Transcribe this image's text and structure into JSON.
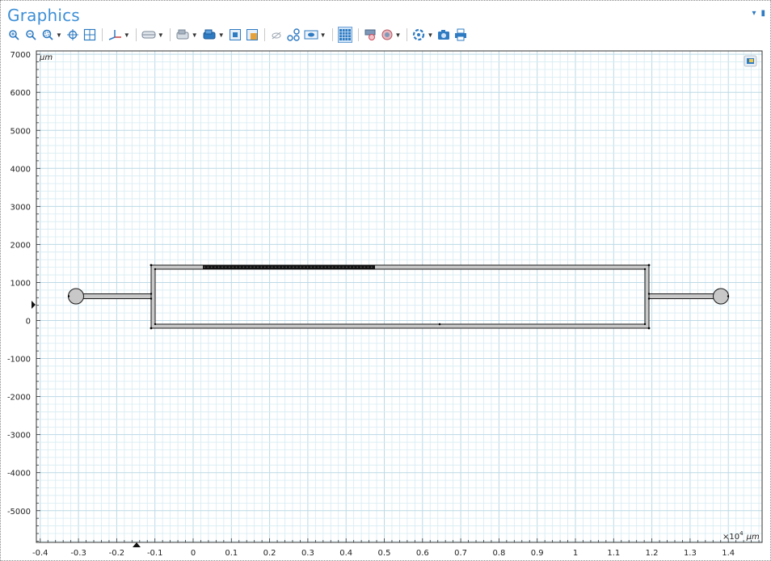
{
  "window": {
    "title": "Graphics",
    "menu_label": "▾",
    "pin_label": "▮"
  },
  "toolbar": {
    "buttons": [
      {
        "name": "zoom-in-icon",
        "dropdown": false
      },
      {
        "name": "zoom-out-icon",
        "dropdown": false
      },
      {
        "name": "zoom-box-icon",
        "dropdown": true
      },
      {
        "name": "pan-center-icon",
        "dropdown": false
      },
      {
        "name": "zoom-extents-icon",
        "dropdown": false
      },
      {
        "name": "axis-view-icon",
        "dropdown": true
      },
      {
        "name": "select-domain-icon",
        "dropdown": true
      },
      {
        "name": "select-boundary-icon",
        "dropdown": true
      },
      {
        "name": "select-object-icon",
        "dropdown": true
      },
      {
        "name": "zoom-selection-icon",
        "dropdown": false
      },
      {
        "name": "clear-selection-icon",
        "dropdown": false
      },
      {
        "name": "hide-icon",
        "dropdown": false
      },
      {
        "name": "show-links-icon",
        "dropdown": false
      },
      {
        "name": "view-mode-icon",
        "dropdown": true
      },
      {
        "name": "grid-toggle-icon",
        "dropdown": false,
        "active": true
      },
      {
        "name": "render-icon",
        "dropdown": false
      },
      {
        "name": "transparency-icon",
        "dropdown": true
      },
      {
        "name": "scene-light-icon",
        "dropdown": true
      },
      {
        "name": "camera-icon",
        "dropdown": false
      },
      {
        "name": "print-icon",
        "dropdown": false
      }
    ]
  },
  "colors": {
    "accent": "#3d8fd6",
    "grid_minor": "#d6ebf2",
    "grid_major": "#bcd9e6",
    "geometry_fill": "#c8c8c8",
    "geometry_edge": "#1a1a1a"
  },
  "axes": {
    "x_ticks": [
      "-0.4",
      "-0.3",
      "-0.2",
      "-0.1",
      "0",
      "0.1",
      "0.2",
      "0.3",
      "0.4",
      "0.5",
      "0.6",
      "0.7",
      "0.8",
      "0.9",
      "1",
      "1.1",
      "1.2",
      "1.3",
      "1.4"
    ],
    "y_ticks": [
      "7000",
      "6000",
      "5000",
      "4000",
      "3000",
      "2000",
      "1000",
      "0",
      "-1000",
      "-2000",
      "-3000",
      "-4000",
      "-5000"
    ],
    "y_unit": "µm",
    "x_multiplier": "×10",
    "x_exponent": "4",
    "x_unit": "µm"
  }
}
